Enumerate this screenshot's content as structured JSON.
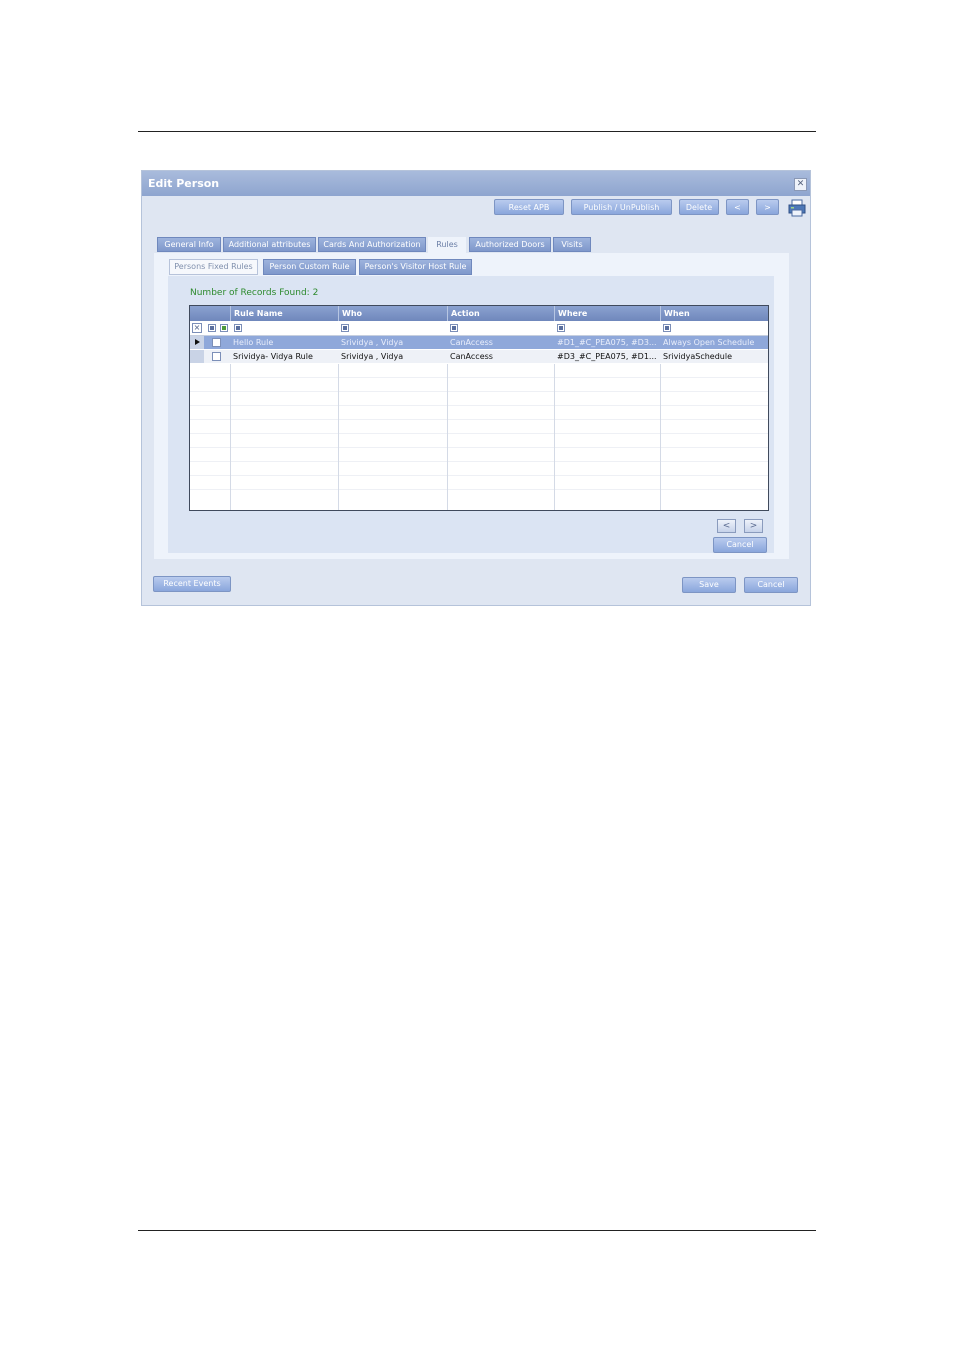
{
  "dialog": {
    "title": "Edit Person",
    "close_glyph": "✕"
  },
  "toolbar": {
    "reset_apb": "Reset APB",
    "publish": "Publish / UnPublish",
    "delete": "Delete",
    "prev": "<",
    "next": ">"
  },
  "tabs": [
    {
      "label": "General Info",
      "active": false
    },
    {
      "label": "Additional attributes",
      "active": false
    },
    {
      "label": "Cards And Authorization",
      "active": false
    },
    {
      "label": "Rules",
      "active": true
    },
    {
      "label": "Authorized Doors",
      "active": false
    },
    {
      "label": "Visits",
      "active": false
    }
  ],
  "subtabs": [
    {
      "label": "Persons Fixed Rules",
      "active": true
    },
    {
      "label": "Person Custom Rule",
      "active": false
    },
    {
      "label": "Person's Visitor Host Rule",
      "active": false
    }
  ],
  "records_text": "Number of Records Found: 2",
  "grid": {
    "columns": [
      "Rule Name",
      "Who",
      "Action",
      "Where",
      "When"
    ],
    "rows": [
      {
        "selected": true,
        "cells": [
          "Hello Rule",
          "Srividya , Vidya",
          "CanAccess",
          "#D1_#C_PEA075, #D3...",
          "Always Open Schedule"
        ]
      },
      {
        "selected": false,
        "cells": [
          "Srividya- Vidya Rule",
          "Srividya , Vidya",
          "CanAccess",
          "#D3_#C_PEA075, #D1...",
          "SrividyaSchedule"
        ]
      }
    ]
  },
  "pager": {
    "prev": "<",
    "next": ">"
  },
  "panel_cancel": "Cancel",
  "footer": {
    "recent_events": "Recent Events",
    "save": "Save",
    "cancel": "Cancel"
  },
  "icons": {
    "close": "close-icon",
    "printer": "printer-icon",
    "filter_clear": "filter-clear-icon",
    "row_pointer": "row-pointer-icon"
  }
}
